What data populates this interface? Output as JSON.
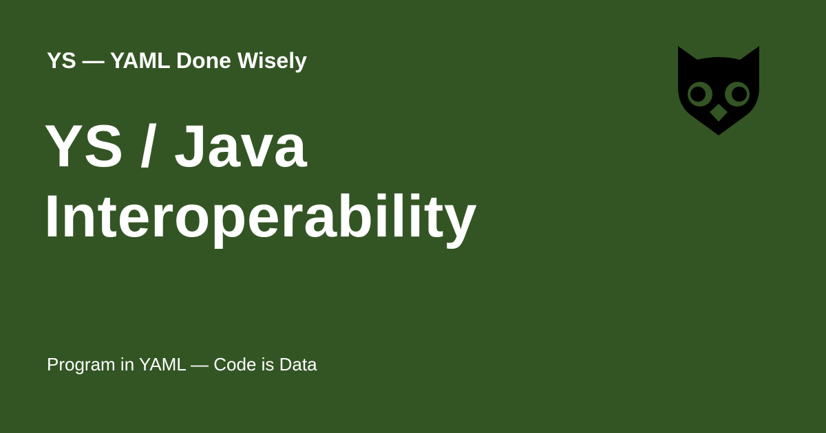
{
  "site": {
    "name": "YS — YAML Done Wisely"
  },
  "page": {
    "title_lines": [
      "YS / Java",
      "Interoperability"
    ],
    "tagline": "Program in YAML — Code is Data"
  },
  "logo": {
    "icon": "owl-icon",
    "color": "#000000"
  },
  "colors": {
    "background": "#335524",
    "text": "#ffffff"
  }
}
